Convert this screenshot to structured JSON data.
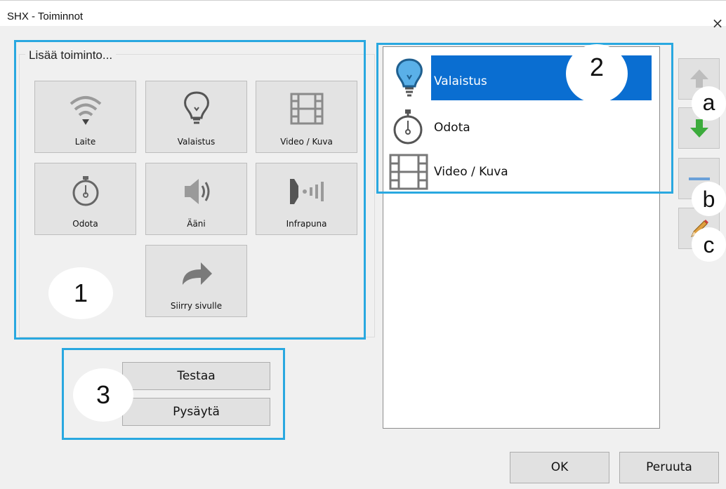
{
  "window": {
    "title": "SHX - Toiminnot",
    "close_glyph": "×"
  },
  "add_group": {
    "label": "Lisää toiminto...",
    "tiles": [
      {
        "label": "Laite",
        "icon": "wifi-icon"
      },
      {
        "label": "Valaistus",
        "icon": "lightbulb-icon"
      },
      {
        "label": "Video / Kuva",
        "icon": "film-icon"
      },
      {
        "label": "Odota",
        "icon": "stopwatch-icon"
      },
      {
        "label": "Ääni",
        "icon": "speaker-icon"
      },
      {
        "label": "Infrapuna",
        "icon": "infrared-icon"
      },
      {
        "label": "Siirry sivulle",
        "icon": "arrow-right-icon"
      }
    ]
  },
  "action_list": {
    "items": [
      {
        "label": "Valaistus",
        "icon": "lightbulb-icon",
        "selected": true
      },
      {
        "label": "Odota",
        "icon": "stopwatch-icon",
        "selected": false
      },
      {
        "label": "Video / Kuva",
        "icon": "film-icon",
        "selected": false
      }
    ],
    "selected_color": "#0a6ed1"
  },
  "side_buttons": [
    {
      "icon": "arrow-up-icon"
    },
    {
      "icon": "arrow-down-icon"
    },
    {
      "icon": "remove-icon"
    },
    {
      "icon": "pencil-icon"
    }
  ],
  "test_group": {
    "test_label": "Testaa",
    "stop_label": "Pysäytä"
  },
  "footer": {
    "ok_label": "OK",
    "cancel_label": "Peruuta"
  },
  "callouts": {
    "one": "1",
    "two": "2",
    "three": "3",
    "a": "a",
    "b": "b",
    "c": "c"
  },
  "colors": {
    "highlight": "#29a8e0",
    "tile_bg": "#e3e3e3",
    "window_bg": "#f0f0f0"
  }
}
